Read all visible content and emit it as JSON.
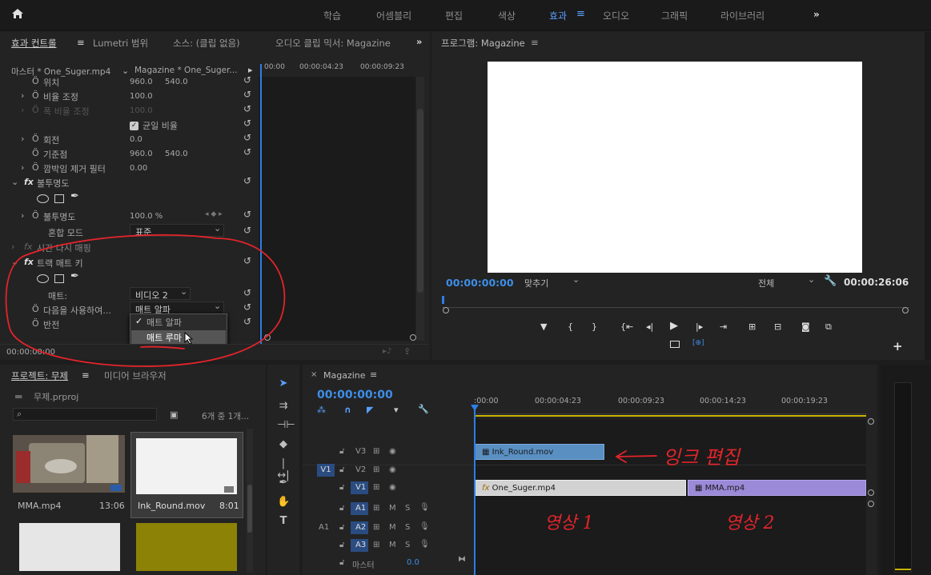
{
  "workspaces": [
    "학습",
    "어셈블리",
    "편집",
    "색상",
    "효과",
    "오디오",
    "그래픽",
    "라이브러리"
  ],
  "active_workspace": "효과",
  "more": "»",
  "effect_panel": {
    "tabs": [
      "효과 컨트롤",
      "Lumetri 범위",
      "소스: (클립 없음)",
      "오디오 클립 믹서: Magazine"
    ],
    "master_label": "마스터 * One_Suger.mp4",
    "sequence_label": "Magazine * One_Suger...",
    "ruler": [
      "00:00",
      "00:00:04:23",
      "00:00:09:23"
    ],
    "rows": {
      "position": "위치",
      "position_v1": "960.0",
      "position_v2": "540.0",
      "scale": "비율 조정",
      "scale_v": "100.0",
      "scale_w": "폭 비율 조정",
      "scale_w_v": "100.0",
      "uniform": "균일 비율",
      "rotation": "회전",
      "rotation_v": "0.0",
      "anchor": "기준점",
      "anchor_v1": "960.0",
      "anchor_v2": "540.0",
      "flicker": "깜박임 제거 필터",
      "flicker_v": "0.00",
      "opacity_group": "불투명도",
      "opacity": "불투명도",
      "opacity_v": "100.0 %",
      "blend": "혼합 모드",
      "blend_v": "표준",
      "time_remap": "시간 다시 매핑",
      "track_matte": "트랙 매트 키",
      "matte": "매트:",
      "matte_v": "비디오 2",
      "composite": "다음을 사용하여...",
      "composite_v": "매트 알파",
      "reverse": "반전"
    },
    "dropdown": [
      "매트 알파",
      "매트 루마"
    ],
    "timecode": "00:00:00:00"
  },
  "program": {
    "title": "프로그램: Magazine",
    "timecode": "00:00:00:00",
    "fit": "맞추기",
    "quality": "전체",
    "duration": "00:00:26:06"
  },
  "project": {
    "tabs": [
      "프로젝트: 무제",
      "미디어 브라우저"
    ],
    "file": "무제.prproj",
    "count": "6개 중 1개...",
    "items": [
      {
        "name": "MMA.mp4",
        "dur": "13:06"
      },
      {
        "name": "Ink_Round.mov",
        "dur": "8:01"
      }
    ]
  },
  "timeline": {
    "tab": "Magazine",
    "timecode": "00:00:00:00",
    "ruler": [
      ":00:00",
      "00:00:04:23",
      "00:00:09:23",
      "00:00:14:23",
      "00:00:19:23"
    ],
    "tracks": {
      "v3": "V3",
      "v2": "V2",
      "v1": "V1",
      "a1": "A1",
      "a2": "A2",
      "a3": "A3",
      "master": "마스터",
      "master_v": "0.0",
      "src_v": "V1",
      "src_a": "A1"
    },
    "clips": {
      "ink": "Ink_Round.mov",
      "one": "One_Suger.mp4",
      "mma": "MMA.mp4"
    }
  },
  "annotations": {
    "ink_edit": "잉크 편집",
    "video1": "영상 1",
    "video2": "영상 2"
  },
  "colors": {
    "accent": "#3d8ee8",
    "clip_blue": "#5a8fc2",
    "clip_purple": "#9a8ad8",
    "annotation_red": "#e3242b"
  }
}
